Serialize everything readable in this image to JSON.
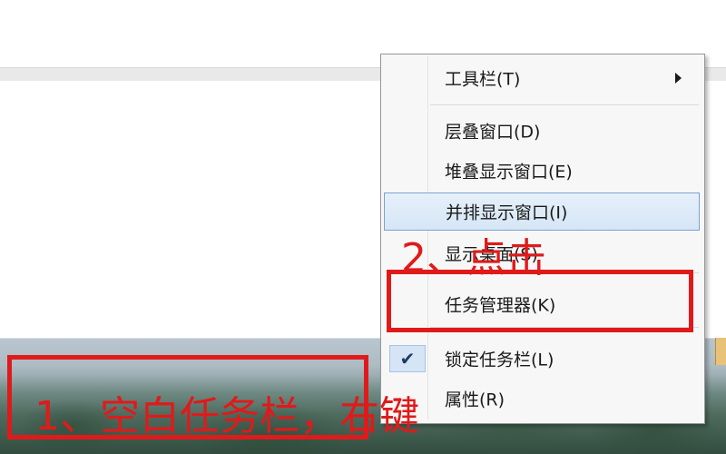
{
  "context_menu": {
    "items": [
      {
        "label": "工具栏(T)",
        "has_submenu": true
      },
      {
        "label": "层叠窗口(D)"
      },
      {
        "label": "堆叠显示窗口(E)"
      },
      {
        "label": "并排显示窗口(I)",
        "highlighted": true
      },
      {
        "label": "显示桌面(S)"
      },
      {
        "label": "任务管理器(K)"
      },
      {
        "label": "锁定任务栏(L)",
        "checked": true
      },
      {
        "label": "属性(R)"
      }
    ],
    "check_icon": "✔"
  },
  "annotations": {
    "step1": "1、空白任务栏，右键",
    "step2": "2、点击",
    "color": "#e01a1a"
  }
}
